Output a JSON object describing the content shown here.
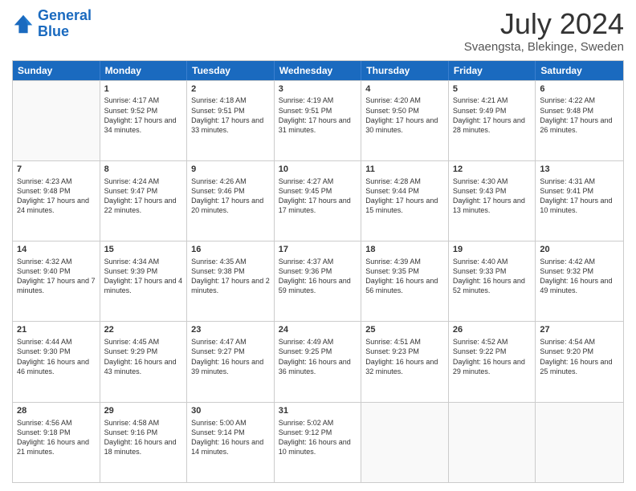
{
  "header": {
    "logo_general": "General",
    "logo_blue": "Blue",
    "month_year": "July 2024",
    "location": "Svaengsta, Blekinge, Sweden"
  },
  "calendar": {
    "days_of_week": [
      "Sunday",
      "Monday",
      "Tuesday",
      "Wednesday",
      "Thursday",
      "Friday",
      "Saturday"
    ],
    "rows": [
      [
        {
          "day": "",
          "empty": true
        },
        {
          "day": "1",
          "sunrise": "4:17 AM",
          "sunset": "9:52 PM",
          "daylight": "17 hours and 34 minutes."
        },
        {
          "day": "2",
          "sunrise": "4:18 AM",
          "sunset": "9:51 PM",
          "daylight": "17 hours and 33 minutes."
        },
        {
          "day": "3",
          "sunrise": "4:19 AM",
          "sunset": "9:51 PM",
          "daylight": "17 hours and 31 minutes."
        },
        {
          "day": "4",
          "sunrise": "4:20 AM",
          "sunset": "9:50 PM",
          "daylight": "17 hours and 30 minutes."
        },
        {
          "day": "5",
          "sunrise": "4:21 AM",
          "sunset": "9:49 PM",
          "daylight": "17 hours and 28 minutes."
        },
        {
          "day": "6",
          "sunrise": "4:22 AM",
          "sunset": "9:48 PM",
          "daylight": "17 hours and 26 minutes."
        }
      ],
      [
        {
          "day": "7",
          "sunrise": "4:23 AM",
          "sunset": "9:48 PM",
          "daylight": "17 hours and 24 minutes."
        },
        {
          "day": "8",
          "sunrise": "4:24 AM",
          "sunset": "9:47 PM",
          "daylight": "17 hours and 22 minutes."
        },
        {
          "day": "9",
          "sunrise": "4:26 AM",
          "sunset": "9:46 PM",
          "daylight": "17 hours and 20 minutes."
        },
        {
          "day": "10",
          "sunrise": "4:27 AM",
          "sunset": "9:45 PM",
          "daylight": "17 hours and 17 minutes."
        },
        {
          "day": "11",
          "sunrise": "4:28 AM",
          "sunset": "9:44 PM",
          "daylight": "17 hours and 15 minutes."
        },
        {
          "day": "12",
          "sunrise": "4:30 AM",
          "sunset": "9:43 PM",
          "daylight": "17 hours and 13 minutes."
        },
        {
          "day": "13",
          "sunrise": "4:31 AM",
          "sunset": "9:41 PM",
          "daylight": "17 hours and 10 minutes."
        }
      ],
      [
        {
          "day": "14",
          "sunrise": "4:32 AM",
          "sunset": "9:40 PM",
          "daylight": "17 hours and 7 minutes."
        },
        {
          "day": "15",
          "sunrise": "4:34 AM",
          "sunset": "9:39 PM",
          "daylight": "17 hours and 4 minutes."
        },
        {
          "day": "16",
          "sunrise": "4:35 AM",
          "sunset": "9:38 PM",
          "daylight": "17 hours and 2 minutes."
        },
        {
          "day": "17",
          "sunrise": "4:37 AM",
          "sunset": "9:36 PM",
          "daylight": "16 hours and 59 minutes."
        },
        {
          "day": "18",
          "sunrise": "4:39 AM",
          "sunset": "9:35 PM",
          "daylight": "16 hours and 56 minutes."
        },
        {
          "day": "19",
          "sunrise": "4:40 AM",
          "sunset": "9:33 PM",
          "daylight": "16 hours and 52 minutes."
        },
        {
          "day": "20",
          "sunrise": "4:42 AM",
          "sunset": "9:32 PM",
          "daylight": "16 hours and 49 minutes."
        }
      ],
      [
        {
          "day": "21",
          "sunrise": "4:44 AM",
          "sunset": "9:30 PM",
          "daylight": "16 hours and 46 minutes."
        },
        {
          "day": "22",
          "sunrise": "4:45 AM",
          "sunset": "9:29 PM",
          "daylight": "16 hours and 43 minutes."
        },
        {
          "day": "23",
          "sunrise": "4:47 AM",
          "sunset": "9:27 PM",
          "daylight": "16 hours and 39 minutes."
        },
        {
          "day": "24",
          "sunrise": "4:49 AM",
          "sunset": "9:25 PM",
          "daylight": "16 hours and 36 minutes."
        },
        {
          "day": "25",
          "sunrise": "4:51 AM",
          "sunset": "9:23 PM",
          "daylight": "16 hours and 32 minutes."
        },
        {
          "day": "26",
          "sunrise": "4:52 AM",
          "sunset": "9:22 PM",
          "daylight": "16 hours and 29 minutes."
        },
        {
          "day": "27",
          "sunrise": "4:54 AM",
          "sunset": "9:20 PM",
          "daylight": "16 hours and 25 minutes."
        }
      ],
      [
        {
          "day": "28",
          "sunrise": "4:56 AM",
          "sunset": "9:18 PM",
          "daylight": "16 hours and 21 minutes."
        },
        {
          "day": "29",
          "sunrise": "4:58 AM",
          "sunset": "9:16 PM",
          "daylight": "16 hours and 18 minutes."
        },
        {
          "day": "30",
          "sunrise": "5:00 AM",
          "sunset": "9:14 PM",
          "daylight": "16 hours and 14 minutes."
        },
        {
          "day": "31",
          "sunrise": "5:02 AM",
          "sunset": "9:12 PM",
          "daylight": "16 hours and 10 minutes."
        },
        {
          "day": "",
          "empty": true
        },
        {
          "day": "",
          "empty": true
        },
        {
          "day": "",
          "empty": true
        }
      ]
    ]
  }
}
